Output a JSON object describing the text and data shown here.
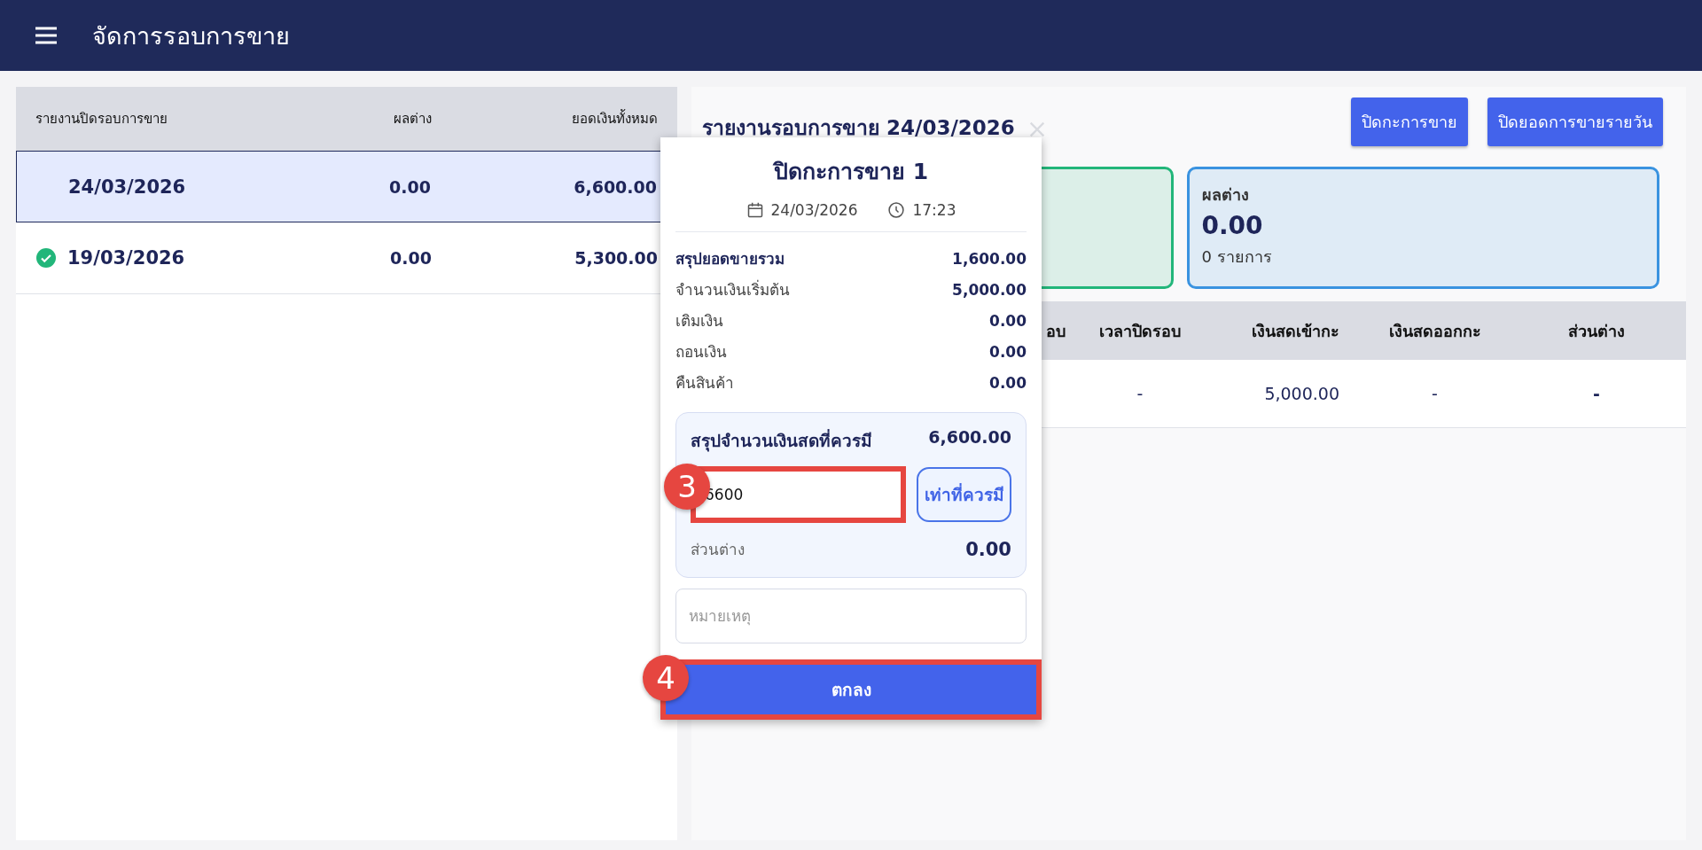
{
  "header": {
    "title": "จัดการรอบการขาย"
  },
  "sales_list": {
    "columns": [
      "รายงานปิดรอบการขาย",
      "ผลต่าง",
      "ยอดเงินทั้งหมด"
    ],
    "rows": [
      {
        "date": "24/03/2026",
        "difference": "0.00",
        "total": "6,600.00",
        "selected": true,
        "closed": false
      },
      {
        "date": "19/03/2026",
        "difference": "0.00",
        "total": "5,300.00",
        "selected": false,
        "closed": true
      }
    ]
  },
  "report": {
    "title": "รายงานรอบการขาย 24/03/2026",
    "buttons": [
      "ปิดกะการขาย",
      "ปิดยอดการขายรายวัน"
    ],
    "cards": [
      {
        "color": "#22b67a"
      },
      {
        "color": "#3a93e0",
        "label": "ผลต่าง",
        "value": "0.00",
        "note": "0 รายการ"
      }
    ],
    "table": {
      "columns": [
        "อบ",
        "เวลาปิดรอบ",
        "เงินสดเข้ากะ",
        "เงินสดออกกะ",
        "ส่วนต่าง"
      ],
      "rows": [
        [
          "",
          "-",
          "5,000.00",
          "-",
          "-"
        ]
      ]
    }
  },
  "popup": {
    "title": "ปิดกะการขาย 1",
    "date": "24/03/2026",
    "time": "17:23",
    "lines": [
      {
        "kind": "total",
        "label": "สรุปยอดขายรวม",
        "value": "1,600.00"
      },
      {
        "kind": "item",
        "label": "จำนวนเงินเริ่มต้น",
        "value": "5,000.00"
      },
      {
        "kind": "item",
        "label": "เติมเงิน",
        "value": "0.00"
      },
      {
        "kind": "item",
        "label": "ถอนเงิน",
        "value": "0.00"
      },
      {
        "kind": "item",
        "label": "คืนสินค้า",
        "value": "0.00"
      }
    ],
    "cash": {
      "label": "สรุปจำนวนเงินสดที่ควรมี",
      "value": "6,600.00",
      "input": "6600",
      "fill_button": "เท่าที่ควรมี",
      "diff_label": "ส่วนต่าง",
      "diff_value": "0.00"
    },
    "remark": {
      "placeholder": "หมายเหตุ"
    },
    "ok_button": "ตกลง"
  },
  "annotations": [
    "3",
    "4"
  ]
}
